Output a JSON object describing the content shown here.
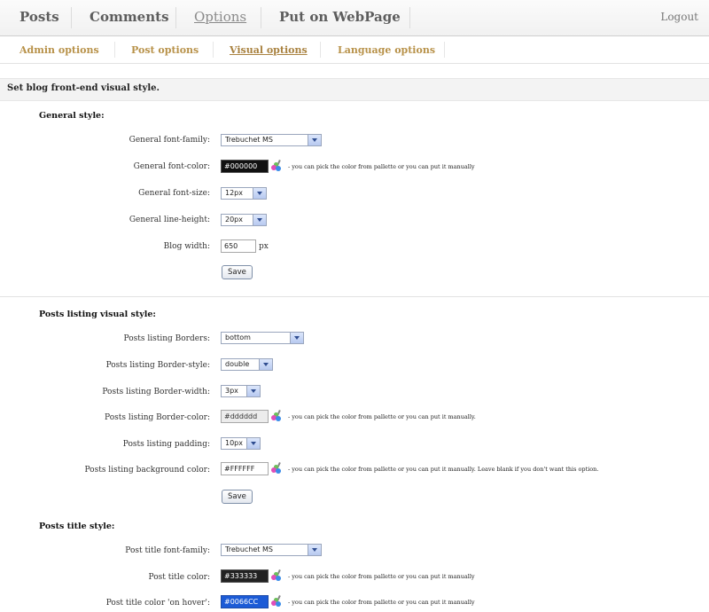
{
  "nav": {
    "items": [
      "Posts",
      "Comments",
      "Options",
      "Put on WebPage"
    ],
    "active": "Options",
    "logout": "Logout"
  },
  "subnav": {
    "items": [
      "Admin options",
      "Post options",
      "Visual options",
      "Language options"
    ],
    "active": "Visual options"
  },
  "page_heading": "Set blog front-end visual style.",
  "general": {
    "title": "General style:",
    "font_family_label": "General font-family:",
    "font_family_value": "Trebuchet MS",
    "font_color_label": "General font-color:",
    "font_color_value": "#000000",
    "font_color_hint": "- you can pick the color from pallette or you can put it manually",
    "font_size_label": "General font-size:",
    "font_size_value": "12px",
    "line_height_label": "General line-height:",
    "line_height_value": "20px",
    "blog_width_label": "Blog width:",
    "blog_width_value": "650",
    "blog_width_unit": "px",
    "save_label": "Save"
  },
  "listing": {
    "title": "Posts listing visual style:",
    "borders_label": "Posts listing Borders:",
    "borders_value": "bottom",
    "border_style_label": "Posts listing Border-style:",
    "border_style_value": "double",
    "border_width_label": "Posts listing Border-width:",
    "border_width_value": "3px",
    "border_color_label": "Posts listing Border-color:",
    "border_color_value": "#dddddd",
    "border_color_hint": "- you can pick the color from pallette or you can put it manually.",
    "padding_label": "Posts listing padding:",
    "padding_value": "10px",
    "bg_color_label": "Posts listing background color:",
    "bg_color_value": "#FFFFFF",
    "bg_color_hint": "- you can pick the color from pallette or you can put it manually. Leave blank if you don't want this option.",
    "save_label": "Save"
  },
  "title_style": {
    "title": "Posts title style:",
    "font_family_label": "Post title font-family:",
    "font_family_value": "Trebuchet MS",
    "color_label": "Post title color:",
    "color_value": "#333333",
    "color_hint": "- you can pick the color from pallette or you can put it manually",
    "hover_label": "Post title color 'on hover':",
    "hover_value": "#0066CC",
    "hover_hint": "- you can pick the color from pallette or you can put it manually"
  }
}
